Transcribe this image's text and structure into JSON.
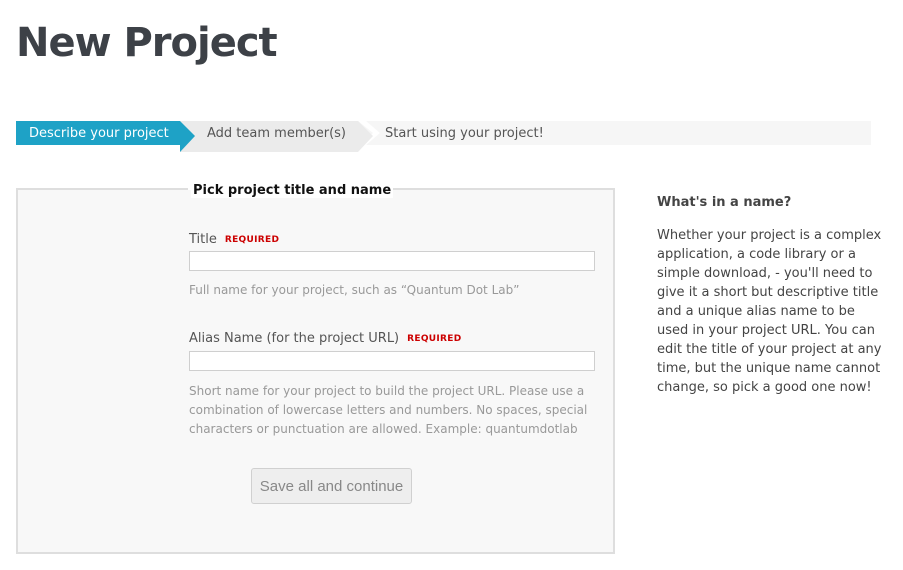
{
  "page": {
    "title": "New Project"
  },
  "steps": [
    {
      "label": "Describe your project",
      "active": true
    },
    {
      "label": "Add team member(s)",
      "active": false
    },
    {
      "label": "Start using your project!",
      "active": false
    }
  ],
  "colors": {
    "active_step": "#1ea2c6",
    "required": "#cc0000"
  },
  "form": {
    "legend": "Pick project title and name",
    "title_field": {
      "label": "Title",
      "required": "REQUIRED",
      "value": "",
      "hint": "Full name for your project, such as “Quantum Dot Lab”"
    },
    "alias_field": {
      "label": "Alias Name (for the project URL)",
      "required": "REQUIRED",
      "value": "",
      "hint": "Short name for your project to build the project URL. Please use a combination of lowercase letters and numbers. No spaces, special characters or punctuation are allowed. Example: quantumdotlab"
    },
    "save_label": "Save all and continue"
  },
  "sidebar": {
    "title": "What's in a name?",
    "text": "Whether your project is a complex application, a code library or a simple download, - you'll need to give it a short but descriptive title and a unique alias name to be used in your project URL. You can edit the title of your project at any time, but the unique name cannot change, so pick a good one now!"
  }
}
